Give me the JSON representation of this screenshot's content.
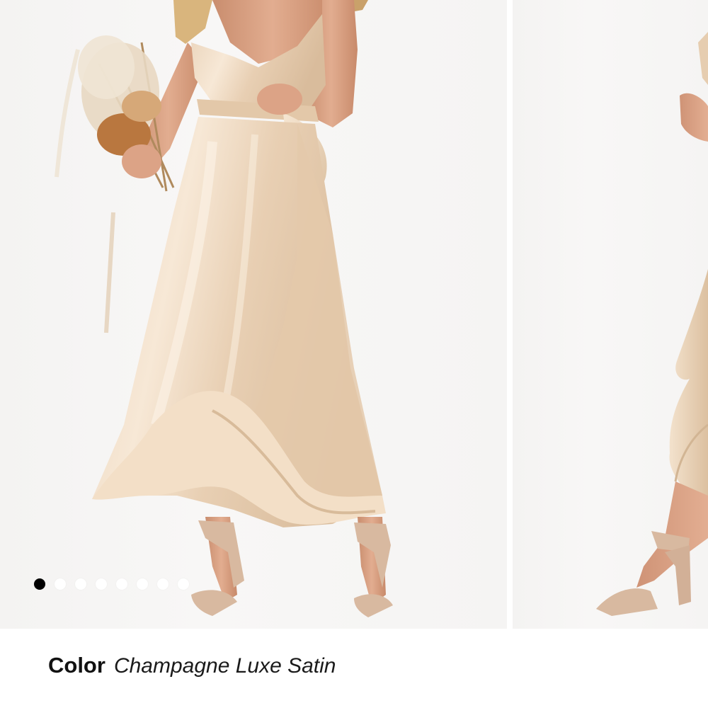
{
  "gallery": {
    "slide_count": 8,
    "active_index": 0,
    "colors": {
      "background": "#f5f4f3",
      "fabric": "#ecd6bd",
      "fabric_highlight": "#f8ead8",
      "fabric_shadow": "#d2b797",
      "skin": "#d9a184",
      "sandal": "#d8b9a0",
      "dot_active": "#000000",
      "dot_inactive": "#ffffff"
    }
  },
  "product": {
    "color_label": "Color",
    "color_value": "Champagne Luxe Satin"
  }
}
